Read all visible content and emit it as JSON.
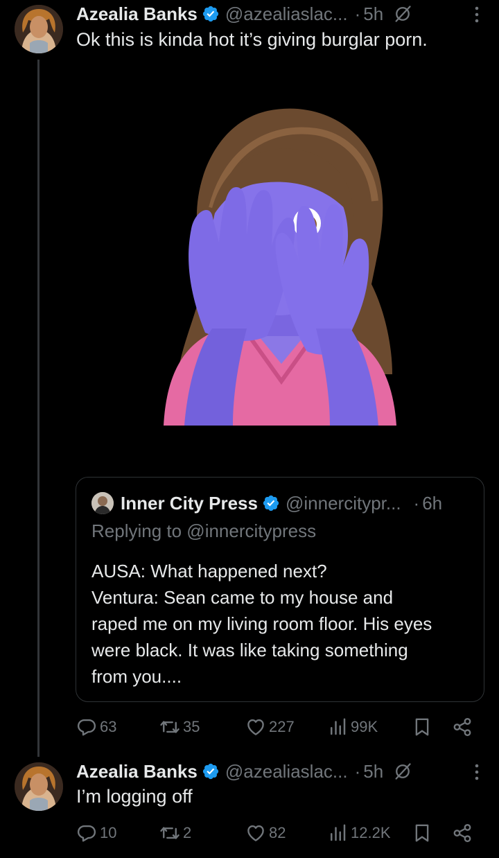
{
  "tweet1": {
    "name": "Azealia Banks",
    "handle": "@azealiaslac...",
    "dot": "·",
    "time": "5h",
    "text": "Ok this is kinda hot it’s giving burglar porn.",
    "quote": {
      "name": "Inner City Press",
      "handle": "@innercitypr...",
      "dot": "·",
      "time": "6h",
      "replying": "Replying to @innercitypress",
      "lines": [
        "AUSA: What happened next?",
        "Ventura: Sean came to my house and",
        "raped me on my living room floor. His eyes",
        "were black. It was like taking something",
        "from you...."
      ]
    },
    "actions": {
      "replies": "63",
      "reposts": "35",
      "likes": "227",
      "views": "99K"
    }
  },
  "tweet2": {
    "name": "Azealia Banks",
    "handle": "@azealiaslac...",
    "dot": "·",
    "time": "5h",
    "text": "I’m logging off",
    "actions": {
      "replies": "10",
      "reposts": "2",
      "likes": "82",
      "views": "12.2K"
    }
  },
  "icons": {
    "verified": "verified-badge-icon",
    "grok": "grok-icon",
    "more": "more-options-icon",
    "reply": "reply-icon",
    "repost": "repost-icon",
    "like": "heart-icon",
    "views": "views-icon",
    "bookmark": "bookmark-icon",
    "share": "share-icon"
  },
  "colors": {
    "background": "#000000",
    "text": "#e7e9ea",
    "muted": "#71767b",
    "verified": "#1d9bf0",
    "border": "#2f3336"
  }
}
